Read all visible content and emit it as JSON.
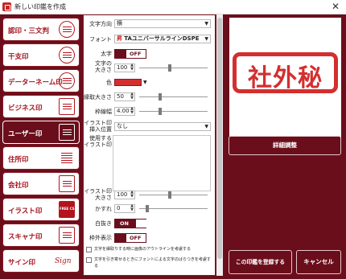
{
  "window": {
    "title": "新しい印鑑を作成",
    "close_glyph": "✕"
  },
  "sidebar": {
    "items": [
      {
        "label": "認印・三文判",
        "thumb": "round-stamp-icon"
      },
      {
        "label": "干支印",
        "thumb": "zodiac-stamp-icon"
      },
      {
        "label": "データーネーム印",
        "thumb": "date-stamp-icon"
      },
      {
        "label": "ビジネス印",
        "thumb": "business-stamp-icon"
      },
      {
        "label": "ユーザー印",
        "thumb": "user-stamp-icon"
      },
      {
        "label": "住所印",
        "thumb": "address-stamp-icon"
      },
      {
        "label": "会社印",
        "thumb": "company-stamp-icon"
      },
      {
        "label": "イラスト印",
        "thumb": "illustration-stamp-icon"
      },
      {
        "label": "スキャナ印",
        "thumb": "scanner-stamp-icon"
      },
      {
        "label": "サイン印",
        "thumb": "signature-stamp-icon"
      }
    ],
    "active_index": 4,
    "script_sample": "Sign",
    "illustration_sample": "FREE CS"
  },
  "settings": {
    "text_direction": {
      "label": "文字方向",
      "value": "横"
    },
    "font": {
      "label": "フォント",
      "prefix": "昇",
      "value": "TAユニバーサルラインDSPE"
    },
    "bold": {
      "label": "太字",
      "state": "OFF"
    },
    "char_size": {
      "label": "文字の\n大きさ",
      "value": "100",
      "level": 0.45
    },
    "color": {
      "label": "色",
      "value_hex": "#d32f2f"
    },
    "frame_size": {
      "label": "縁取大きさ",
      "value": "50",
      "level": 0.3
    },
    "frame_width": {
      "label": "枠線幅",
      "value": "4.00",
      "level": 0.3
    },
    "illustration_insert": {
      "label": "イラスト印\n挿入位置",
      "value": "なし"
    },
    "use_illustration": {
      "label": "使用する\nイラスト印"
    },
    "illustration_size": {
      "label": "イラスト印\n大きさ",
      "value": "100",
      "level": 0.45
    },
    "blur": {
      "label": "かすれ",
      "value": "0",
      "level": 0.1
    },
    "white_text": {
      "label": "白抜き",
      "state": "ON"
    },
    "outer_frame": {
      "label": "枠外表示",
      "state": "OFF"
    },
    "check_outline": "文字を縁取りする時に画像のアウトラインを考慮する",
    "check_space": "文字を引き寄せるときにフォントによる文字のばらつきを考慮する"
  },
  "preview": {
    "text": "社外秘",
    "color_hex": "#d32f2f"
  },
  "buttons": {
    "detail": "詳細調整",
    "register": "この印鑑を登録する",
    "cancel": "キャンセル"
  },
  "colors": {
    "accent": "#6b0e1c",
    "stamp_red": "#d32f2f"
  }
}
